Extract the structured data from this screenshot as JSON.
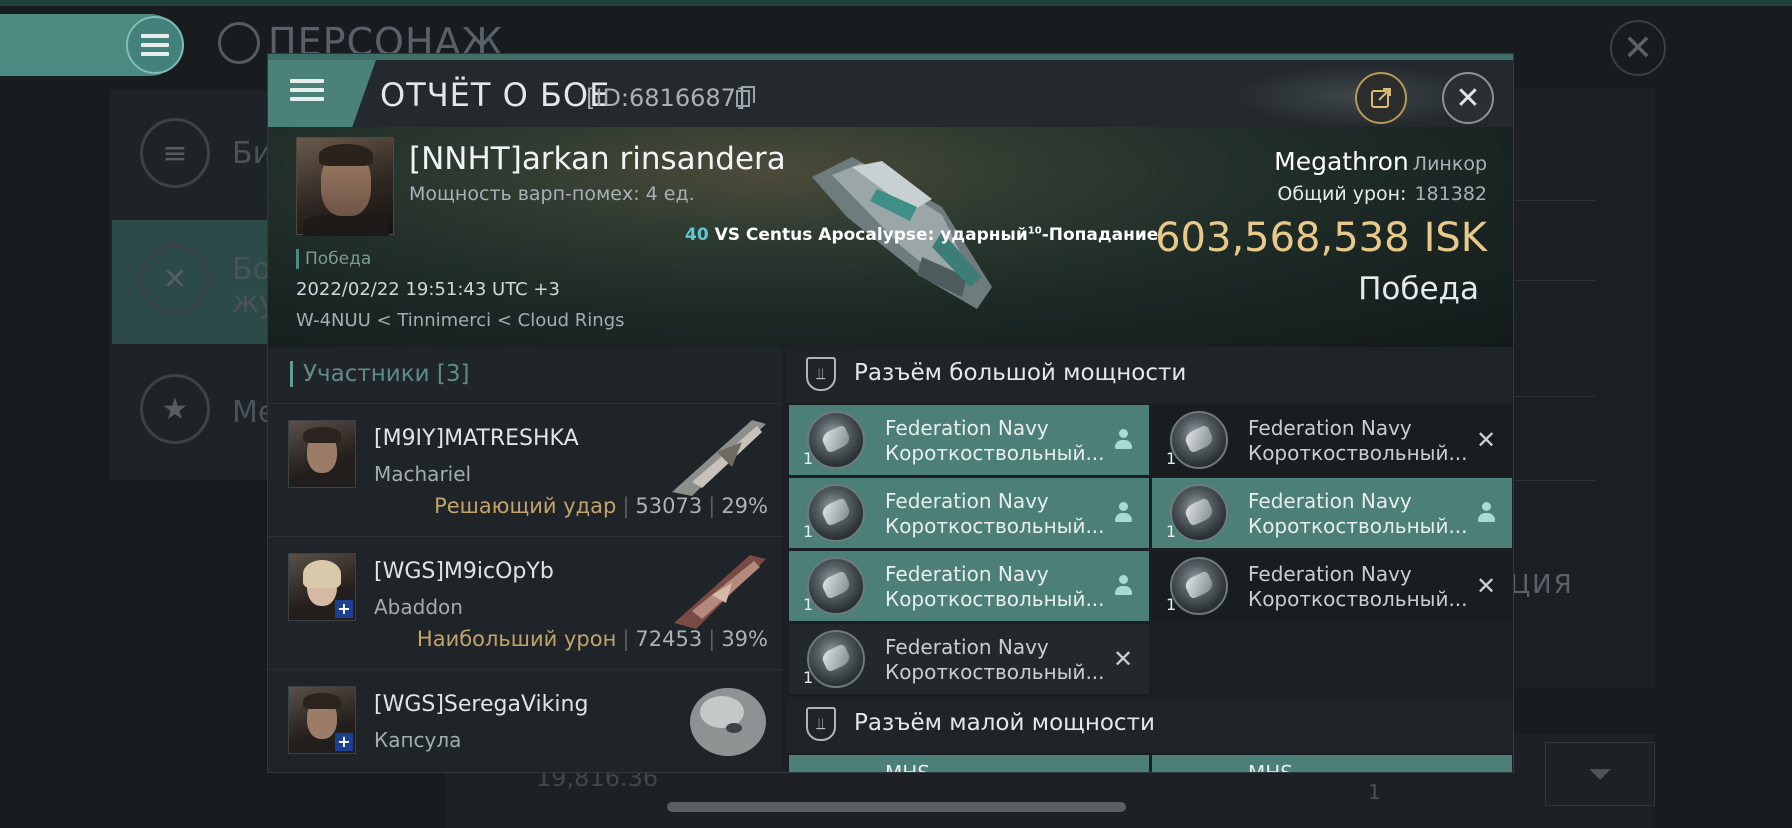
{
  "background": {
    "title": "ПЕРСОНАЖ",
    "left_items": [
      "Би",
      "Бо",
      "жу",
      "Ме"
    ],
    "right_partial": "ЦИЯ",
    "bottom_value": "19,816.36",
    "bottom_small": "1"
  },
  "dialog": {
    "title": "ОТЧЁТ О БОЕ",
    "report_id": "[ID:6816687]"
  },
  "victim": {
    "name": "[NNHT]arkan rinsandera",
    "warp_strength": "Мощность варп-помех: 4 ед.",
    "result_small": "Победа",
    "datetime": "2022/02/22 19:51:43 UTC +3",
    "location": "W-4NUU < Tinnimerci < Cloud Rings",
    "vs_count": "40",
    "vs_text": "VS Centus Apocalypse: ударный",
    "vs_sup": "10",
    "vs_suffix": "-Попадание",
    "ship": "Megathron",
    "ship_class": "Линкор",
    "damage_label": "Общий урон:",
    "damage_value": "181382",
    "isk_value": "603,568,538",
    "isk_unit": "ISK",
    "result_big": "Победа"
  },
  "participants": {
    "title": "Участники [3]",
    "rows": [
      {
        "name": "[M9IY]MATRESHKA",
        "ship": "Machariel",
        "tag": "Решающий удар",
        "damage": "53073",
        "percent": "29%"
      },
      {
        "name": "[WGS]M9icOpYb",
        "ship": "Abaddon",
        "tag": "Наибольший урон",
        "damage": "72453",
        "percent": "39%"
      },
      {
        "name": "[WGS]SeregaViking",
        "ship": "Капсула",
        "tag": "",
        "damage": "",
        "percent": ""
      }
    ]
  },
  "modules": {
    "high_title": "Разъём большой мощности",
    "low_title": "Разъём малой мощности",
    "slots": [
      {
        "line1": "Federation Navy",
        "line2": "Короткоствольный...",
        "qty": "1",
        "state": "fitted"
      },
      {
        "line1": "Federation Navy",
        "line2": "Короткоствольный...",
        "qty": "1",
        "state": "destroyed"
      },
      {
        "line1": "Federation Navy",
        "line2": "Короткоствольный...",
        "qty": "1",
        "state": "fitted"
      },
      {
        "line1": "Federation Navy",
        "line2": "Короткоствольный...",
        "qty": "1",
        "state": "fitted"
      },
      {
        "line1": "Federation Navy",
        "line2": "Короткоствольный...",
        "qty": "1",
        "state": "fitted"
      },
      {
        "line1": "Federation Navy",
        "line2": "Короткоствольный...",
        "qty": "1",
        "state": "destroyed"
      },
      {
        "line1": "Federation Navy",
        "line2": "Короткоствольный...",
        "qty": "1",
        "state": "destroyed"
      }
    ],
    "low_partial": [
      "MHS",
      "MHS"
    ]
  },
  "colors": {
    "accent": "#4b7f78",
    "gold": "#e8c98a",
    "tag_gold": "#c4a36a",
    "cyan_num": "#5ec7d4"
  },
  "icons": [
    "menu-icon",
    "copy-icon",
    "share-icon",
    "close-icon",
    "pilot-icon",
    "destroyed-icon",
    "high-slot-icon",
    "low-slot-icon",
    "filter-icon"
  ]
}
